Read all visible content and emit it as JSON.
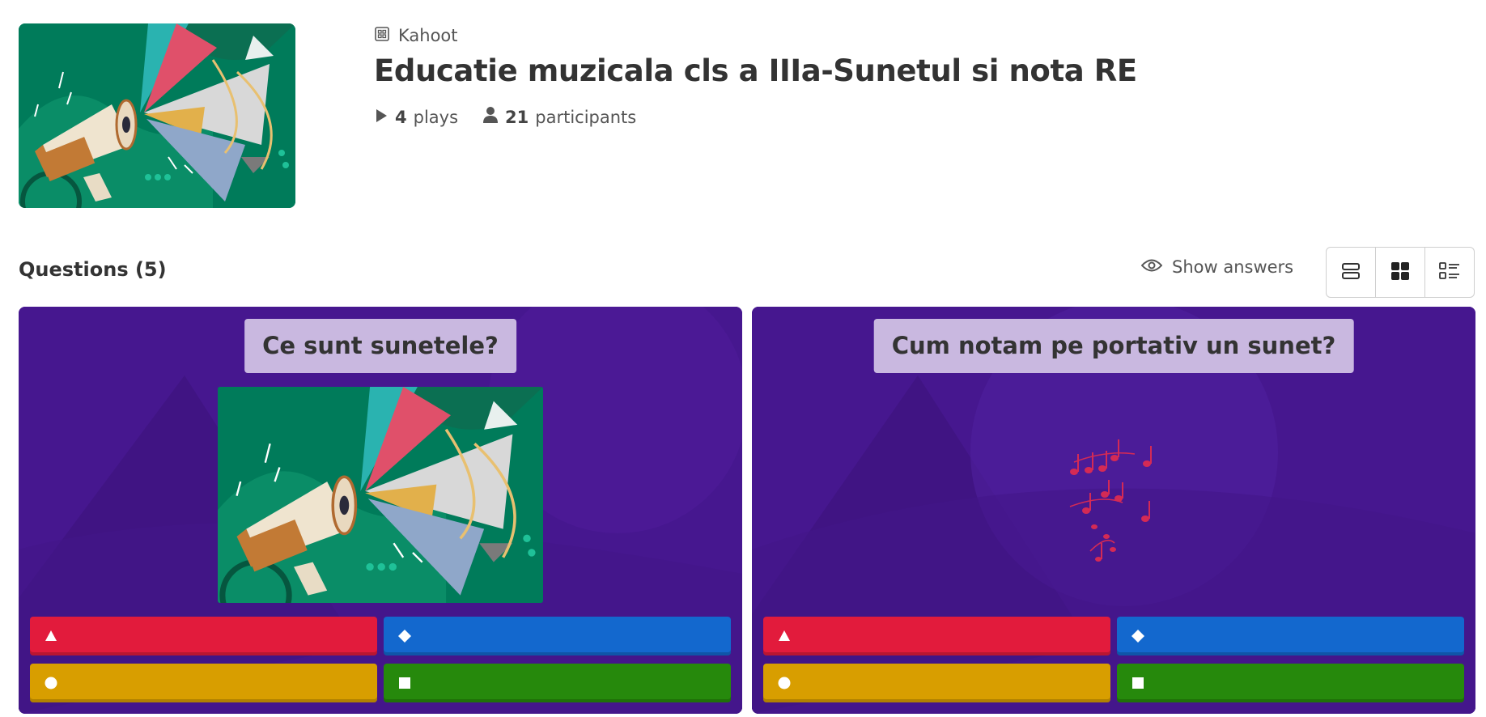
{
  "kahoot": {
    "type_label": "Kahoot",
    "title": "Educatie muzicala cls a IIIa-Sunetul si nota RE",
    "plays_count": "4",
    "plays_label": "plays",
    "participants_count": "21",
    "participants_label": "participants"
  },
  "toolbar": {
    "questions_heading": "Questions (5)",
    "show_answers_label": "Show answers",
    "view_modes": [
      "list-view",
      "grid-view",
      "detail-view"
    ]
  },
  "questions": [
    {
      "title": "Ce sunt sunetele?",
      "media": "megaphone-illustration",
      "answers": [
        {
          "color": "#e21b3c",
          "shape": "triangle"
        },
        {
          "color": "#1368ce",
          "shape": "diamond"
        },
        {
          "color": "#d89e00",
          "shape": "circle"
        },
        {
          "color": "#26890c",
          "shape": "square"
        }
      ]
    },
    {
      "title": "Cum notam pe portativ un sunet?",
      "media": "music-notes",
      "answers": [
        {
          "color": "#e21b3c",
          "shape": "triangle"
        },
        {
          "color": "#1368ce",
          "shape": "diamond"
        },
        {
          "color": "#d89e00",
          "shape": "circle"
        },
        {
          "color": "#26890c",
          "shape": "square"
        }
      ]
    }
  ],
  "colors": {
    "card_background": "#46178f",
    "question_title_bg": "#c9b8e0",
    "cover_green": "#007b5a"
  }
}
